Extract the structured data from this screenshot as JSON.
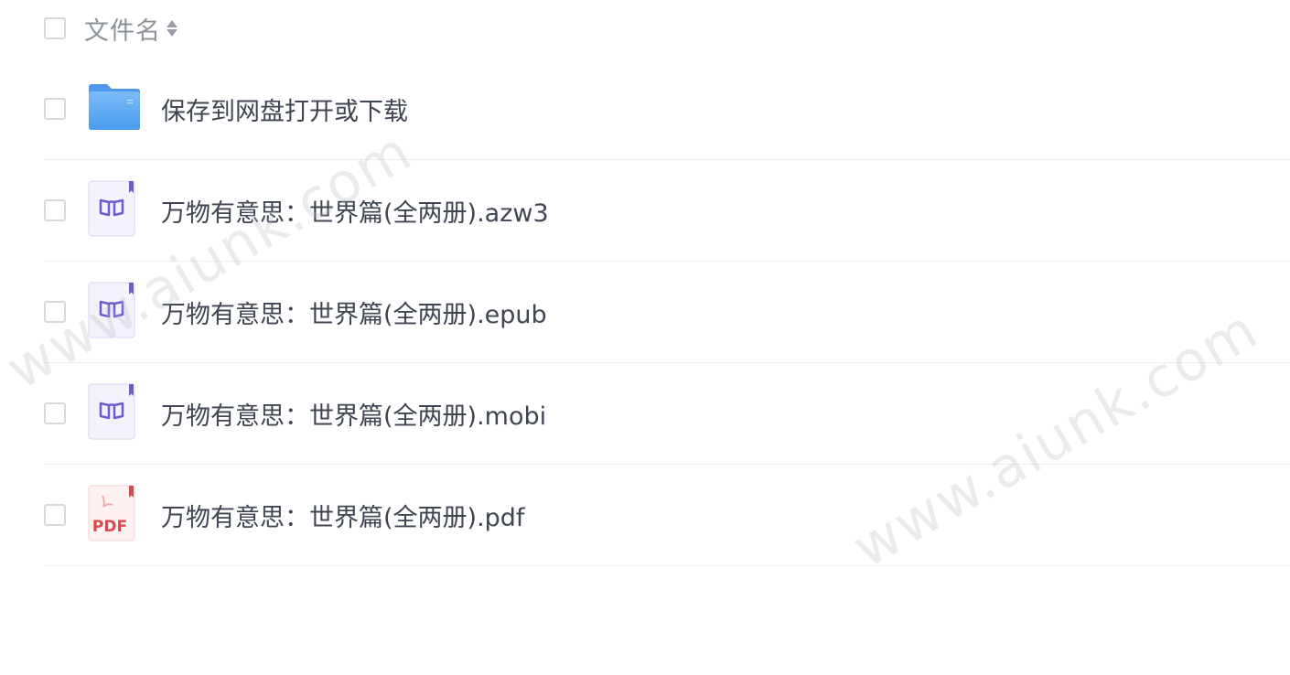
{
  "header": {
    "column_label": "文件名"
  },
  "files": [
    {
      "name": "保存到网盘打开或下载",
      "type": "folder",
      "icon": "folder-icon"
    },
    {
      "name": "万物有意思：世界篇(全两册).azw3",
      "type": "ebook",
      "icon": "ebook-icon"
    },
    {
      "name": "万物有意思：世界篇(全两册).epub",
      "type": "ebook",
      "icon": "ebook-icon"
    },
    {
      "name": "万物有意思：世界篇(全两册).mobi",
      "type": "ebook",
      "icon": "ebook-icon"
    },
    {
      "name": "万物有意思：世界篇(全两册).pdf",
      "type": "pdf",
      "icon": "pdf-icon",
      "icon_text": "PDF"
    }
  ],
  "watermark": {
    "text": "www.aiunk.com"
  },
  "colors": {
    "folder": "#5aa9f5",
    "ebook": "#7a6ad8",
    "pdf": "#e0454b"
  }
}
